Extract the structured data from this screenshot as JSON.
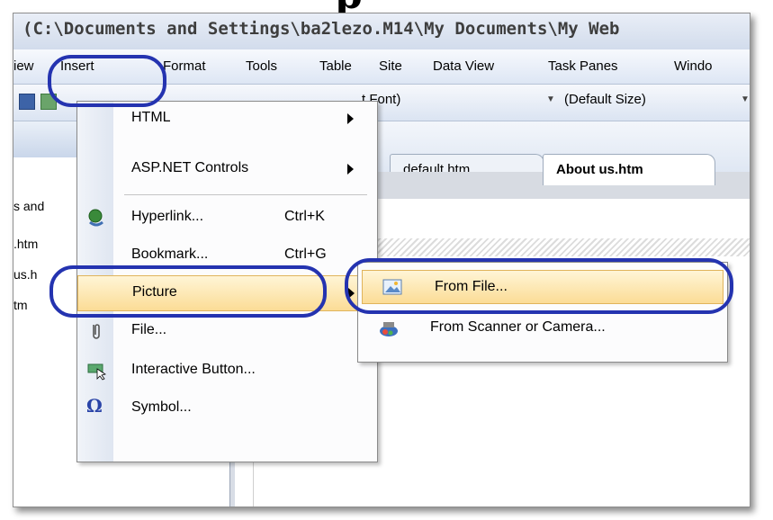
{
  "page_heading": "p                          ",
  "window": {
    "path": "(C:\\Documents and Settings\\ba2lezo.M14\\My Documents\\My Web"
  },
  "menubar": {
    "items": [
      {
        "label": "iew"
      },
      {
        "label": "Insert"
      },
      {
        "label": "Format"
      },
      {
        "label": "Tools"
      },
      {
        "label": "Table"
      },
      {
        "label": "Site"
      },
      {
        "label": "Data View"
      },
      {
        "label": "Task Panes"
      },
      {
        "label": "Windo"
      }
    ]
  },
  "toolbar": {
    "font_value": "t Font)",
    "size_value": "(Default Size)"
  },
  "left_pane": {
    "lines": [
      "s and",
      ".htm",
      "us.h",
      "tm"
    ]
  },
  "tabs": [
    {
      "label": "default.htm"
    },
    {
      "label": "About us.htm"
    }
  ],
  "insert_menu": {
    "items": [
      {
        "label": "HTML",
        "submenu": true
      },
      {
        "label": "ASP.NET Controls",
        "submenu": true
      },
      {
        "label": "Hyperlink...",
        "shortcut": "Ctrl+K",
        "icon": "hyperlink-globe-icon"
      },
      {
        "label": "Bookmark...",
        "shortcut": "Ctrl+G"
      },
      {
        "label": "Picture",
        "submenu": true,
        "highlighted": true
      },
      {
        "label": "File...",
        "icon": "paperclip-icon"
      },
      {
        "label": "Interactive Button...",
        "icon": "interactive-button-icon"
      },
      {
        "label": "Symbol...",
        "icon": "omega-symbol-icon"
      }
    ]
  },
  "picture_submenu": {
    "items": [
      {
        "label": "From File...",
        "icon": "picture-icon",
        "highlighted": true
      },
      {
        "label": "From Scanner or Camera...",
        "icon": "scanner-camera-icon"
      }
    ]
  },
  "colors": {
    "highlight_ring": "#2433b0",
    "menu_highlight": "#fbdc96"
  }
}
